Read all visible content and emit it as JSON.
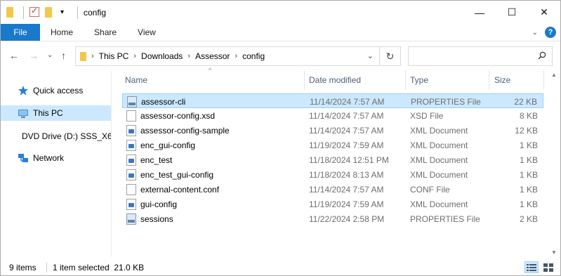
{
  "window": {
    "title": "config",
    "controls": {
      "minimize": "—",
      "maximize": "☐",
      "close": "✕"
    }
  },
  "ribbon": {
    "file_tab": "File",
    "tabs": [
      "Home",
      "Share",
      "View"
    ]
  },
  "address": {
    "crumbs": [
      "This PC",
      "Downloads",
      "Assessor",
      "config"
    ],
    "search_placeholder": ""
  },
  "sidebar": {
    "items": [
      {
        "label": "Quick access",
        "icon": "star-icon"
      },
      {
        "label": "This PC",
        "icon": "computer-icon",
        "selected": true
      },
      {
        "label": "DVD Drive (D:) SSS_X6",
        "icon": "dvd-drive-icon"
      },
      {
        "label": "Network",
        "icon": "network-icon"
      }
    ]
  },
  "columns": {
    "name": "Name",
    "date": "Date modified",
    "type": "Type",
    "size": "Size"
  },
  "files": [
    {
      "name": "assessor-cli",
      "date": "11/14/2024 7:57 AM",
      "type": "PROPERTIES File",
      "size": "22 KB",
      "icon": "properties-file-icon",
      "selected": true
    },
    {
      "name": "assessor-config.xsd",
      "date": "11/14/2024 7:57 AM",
      "type": "XSD File",
      "size": "8 KB",
      "icon": "generic-file-icon"
    },
    {
      "name": "assessor-config-sample",
      "date": "11/14/2024 7:57 AM",
      "type": "XML Document",
      "size": "12 KB",
      "icon": "xml-file-icon"
    },
    {
      "name": "enc_gui-config",
      "date": "11/19/2024 7:59 AM",
      "type": "XML Document",
      "size": "1 KB",
      "icon": "xml-file-icon"
    },
    {
      "name": "enc_test",
      "date": "11/18/2024 12:51 PM",
      "type": "XML Document",
      "size": "1 KB",
      "icon": "xml-file-icon"
    },
    {
      "name": "enc_test_gui-config",
      "date": "11/18/2024 8:13 AM",
      "type": "XML Document",
      "size": "1 KB",
      "icon": "xml-file-icon"
    },
    {
      "name": "external-content.conf",
      "date": "11/14/2024 7:57 AM",
      "type": "CONF File",
      "size": "1 KB",
      "icon": "generic-file-icon"
    },
    {
      "name": "gui-config",
      "date": "11/19/2024 7:59 AM",
      "type": "XML Document",
      "size": "1 KB",
      "icon": "xml-file-icon"
    },
    {
      "name": "sessions",
      "date": "11/22/2024 2:58 PM",
      "type": "PROPERTIES File",
      "size": "2 KB",
      "icon": "properties-file-icon"
    }
  ],
  "status": {
    "item_count": "9 items",
    "selection": "1 item selected  21.0 KB"
  },
  "colors": {
    "accent": "#1979ca",
    "selection": "#cce8ff",
    "selection_border": "#99d1ff"
  }
}
